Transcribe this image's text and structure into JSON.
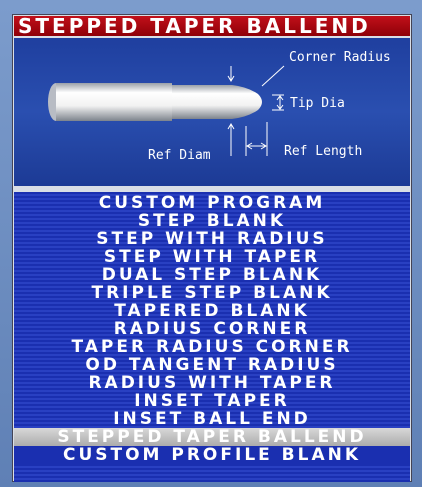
{
  "title": "STEPPED TAPER BALLEND",
  "diagram": {
    "corner_radius_label": "Corner Radius",
    "tip_dia_label": "Tip Dia",
    "ref_diam_label": "Ref Diam",
    "ref_length_label": "Ref Length"
  },
  "menu": {
    "selected_index": 13,
    "items": [
      "CUSTOM PROGRAM",
      "STEP BLANK",
      "STEP WITH RADIUS",
      "STEP WITH TAPER",
      "DUAL STEP BLANK",
      "TRIPLE STEP BLANK",
      "TAPERED BLANK",
      "RADIUS CORNER",
      "TAPER RADIUS CORNER",
      "OD TANGENT RADIUS",
      "RADIUS WITH TAPER",
      "INSET TAPER",
      "INSET BALL END",
      "STEPPED TAPER BALLEND",
      "CUSTOM PROFILE BLANK"
    ]
  },
  "colors": {
    "title_bg": "#b00010",
    "menu_bg": "#1a2fb0",
    "selected_bg": "#bcbcbc",
    "diagram_bg": "#2446a8"
  }
}
